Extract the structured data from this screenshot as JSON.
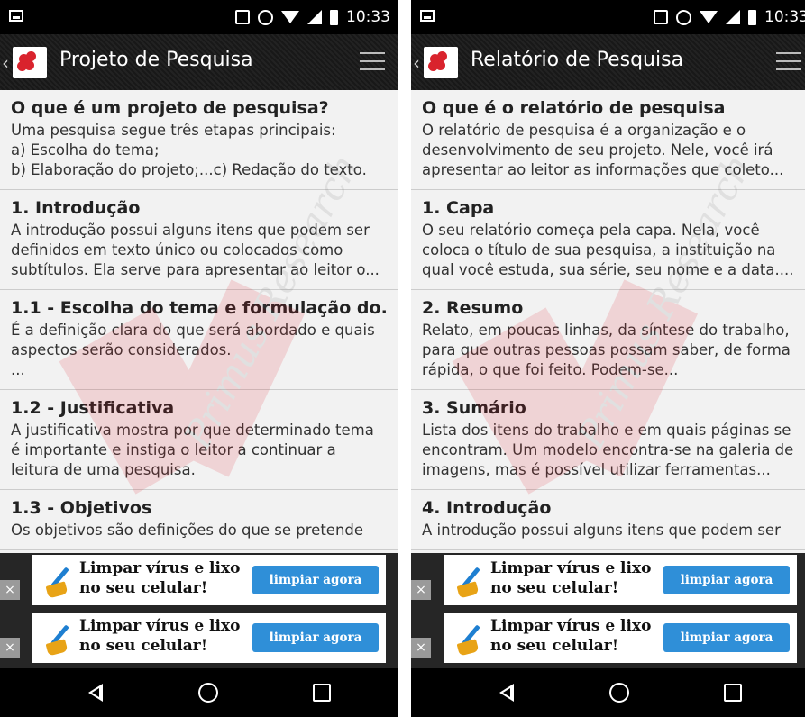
{
  "status": {
    "time": "10:33"
  },
  "left": {
    "title": "Projeto de Pesquisa",
    "items": [
      {
        "title": "O que é um projeto de pesquisa?",
        "text": "Uma pesquisa segue três etapas principais:\na) Escolha do tema;\nb) Elaboração do projeto;...c) Redação do texto."
      },
      {
        "title": "1. Introdução",
        "text": "A introdução possui alguns itens que podem ser definidos em texto único ou colocados como subtítulos. Ela serve para apresentar ao leitor o..."
      },
      {
        "title": "1.1 - Escolha do tema e formulação do...",
        "text": "É a definição clara do que será abordado e quais aspectos serão considerados.\n..."
      },
      {
        "title": "1.2 - Justificativa",
        "text": "A justificativa mostra por que determinado tema é importante e instiga o leitor a continuar a leitura de uma pesquisa."
      },
      {
        "title": "1.3 - Objetivos",
        "text": "Os objetivos são definições do que se pretende"
      }
    ]
  },
  "right": {
    "title": "Relatório de Pesquisa",
    "items": [
      {
        "title": "O que é o relatório de pesquisa",
        "text": "O relatório de pesquisa é a organização e o desenvolvimento de seu projeto. Nele, você irá apresentar ao leitor as informações que coleto..."
      },
      {
        "title": "1. Capa",
        "text": "O seu relatório começa pela capa. Nela, você coloca o título de sua pesquisa, a instituição na qual você estuda, sua série, seu nome e a data...."
      },
      {
        "title": "2. Resumo",
        "text": "Relato, em poucas linhas, da síntese do trabalho, para que outras pessoas possam saber, de forma rápida, o que foi feito. Podem-se..."
      },
      {
        "title": "3. Sumário",
        "text": "Lista dos itens do trabalho e em quais páginas se encontram. Um modelo encontra-se na galeria de imagens, mas é possível utilizar ferramentas..."
      },
      {
        "title": "4. Introdução",
        "text": "A introdução possui alguns itens que podem ser"
      }
    ]
  },
  "ad": {
    "text": "Limpar vírus e lixo\nno seu celular!",
    "button": "limpiar agora",
    "close": "×"
  },
  "watermark": "Primus Research",
  "colors": {
    "accent_red": "#e0202a",
    "ad_button": "#2f8fd8",
    "appbar": "#1c1c1c"
  }
}
